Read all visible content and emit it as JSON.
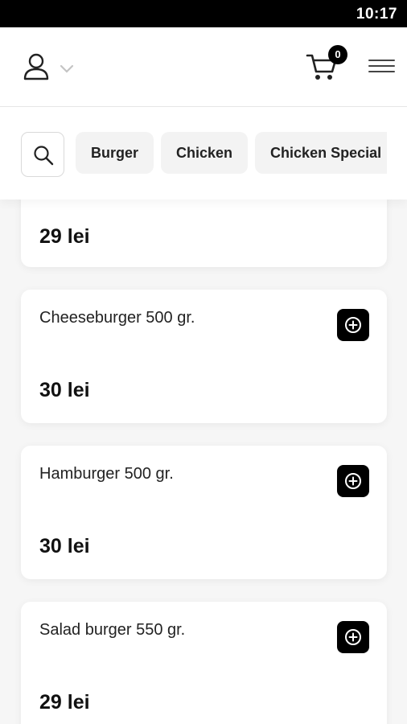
{
  "status_bar": {
    "time": "10:17"
  },
  "header": {
    "user_icon": "user-icon",
    "chevron_icon": "chevron-down-icon",
    "cart_icon": "cart-icon",
    "cart_count": "0",
    "menu_icon": "hamburger-menu-icon"
  },
  "categories": {
    "search_icon": "search-icon",
    "items": [
      {
        "label": "Burger"
      },
      {
        "label": "Chicken"
      },
      {
        "label": "Chicken Special"
      }
    ]
  },
  "products": [
    {
      "name": "",
      "price": "29 lei"
    },
    {
      "name": "Cheeseburger 500 gr.",
      "price": "30 lei"
    },
    {
      "name": "Hamburger 500 gr.",
      "price": "30 lei"
    },
    {
      "name": "Salad burger 550 gr.",
      "price": "29 lei"
    }
  ],
  "colors": {
    "accent": "#000000",
    "background": "#f6f6f6",
    "card": "#ffffff",
    "chip": "#f3f3f3"
  }
}
